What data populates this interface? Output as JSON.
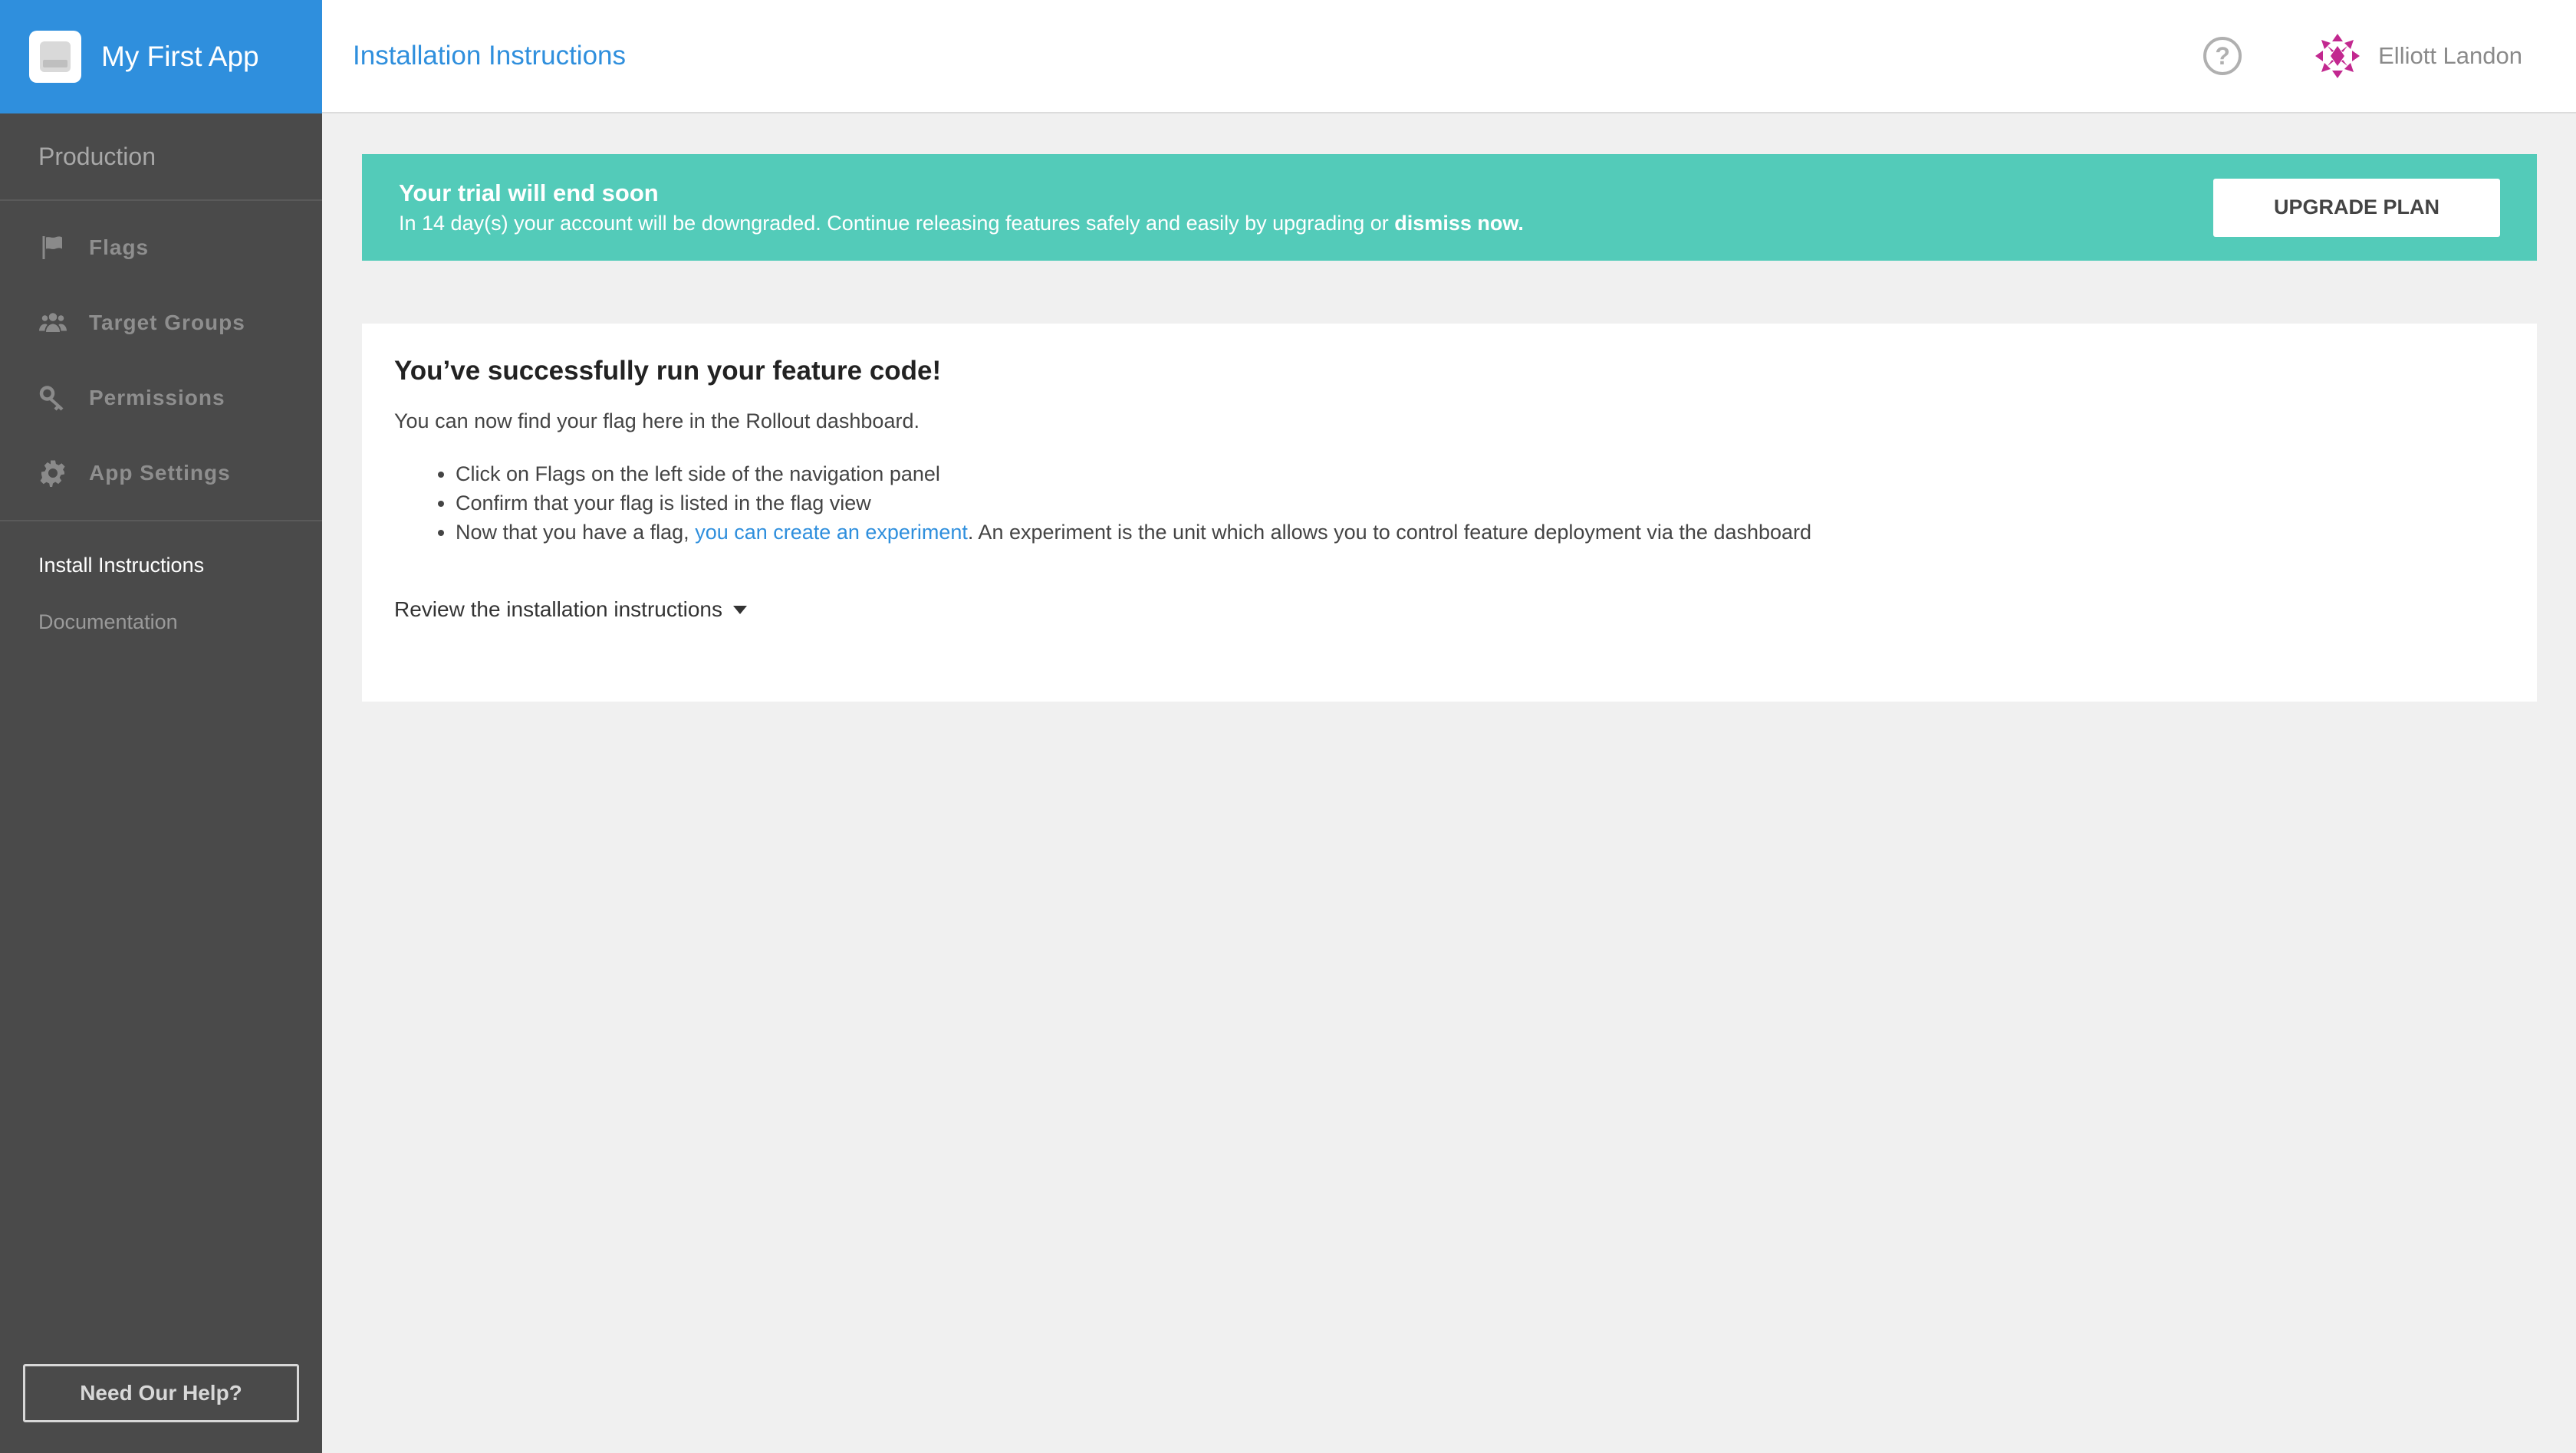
{
  "app": {
    "name": "My First App"
  },
  "sidebar": {
    "environment": "Production",
    "items": [
      {
        "label": "Flags",
        "icon": "flag-icon"
      },
      {
        "label": "Target Groups",
        "icon": "users-icon"
      },
      {
        "label": "Permissions",
        "icon": "key-icon"
      },
      {
        "label": "App Settings",
        "icon": "gear-icon"
      }
    ],
    "sub_items": [
      {
        "label": "Install Instructions",
        "active": true
      },
      {
        "label": "Documentation",
        "active": false
      }
    ],
    "help_button": "Need Our Help?"
  },
  "header": {
    "title": "Installation Instructions",
    "help_icon": "?",
    "user_name": "Elliott Landon"
  },
  "banner": {
    "title": "Your trial will end soon",
    "body_prefix": "In 14 day(s) your account will be downgraded. Continue releasing features safely and easily by upgrading or",
    "dismiss_link": "dismiss now.",
    "upgrade_button": "UPGRADE PLAN",
    "color": "#53cbb9"
  },
  "card": {
    "title": "You’ve successfully run your feature code!",
    "intro": "You can now find your flag here in the Rollout dashboard.",
    "steps": {
      "step1": "Click on Flags on the left side of the navigation panel",
      "step2": "Confirm that your flag is listed in the flag view",
      "step3_prefix": "Now that you have a flag,",
      "step3_link": "you can create an experiment",
      "step3_suffix": ". An experiment is the unit which allows you to control feature deployment via the dashboard"
    },
    "review_toggle": "Review the installation instructions"
  },
  "colors": {
    "accent": "#2f8fdd",
    "sidebar_bg": "#4a4a4a",
    "avatar": "#c2288f"
  }
}
